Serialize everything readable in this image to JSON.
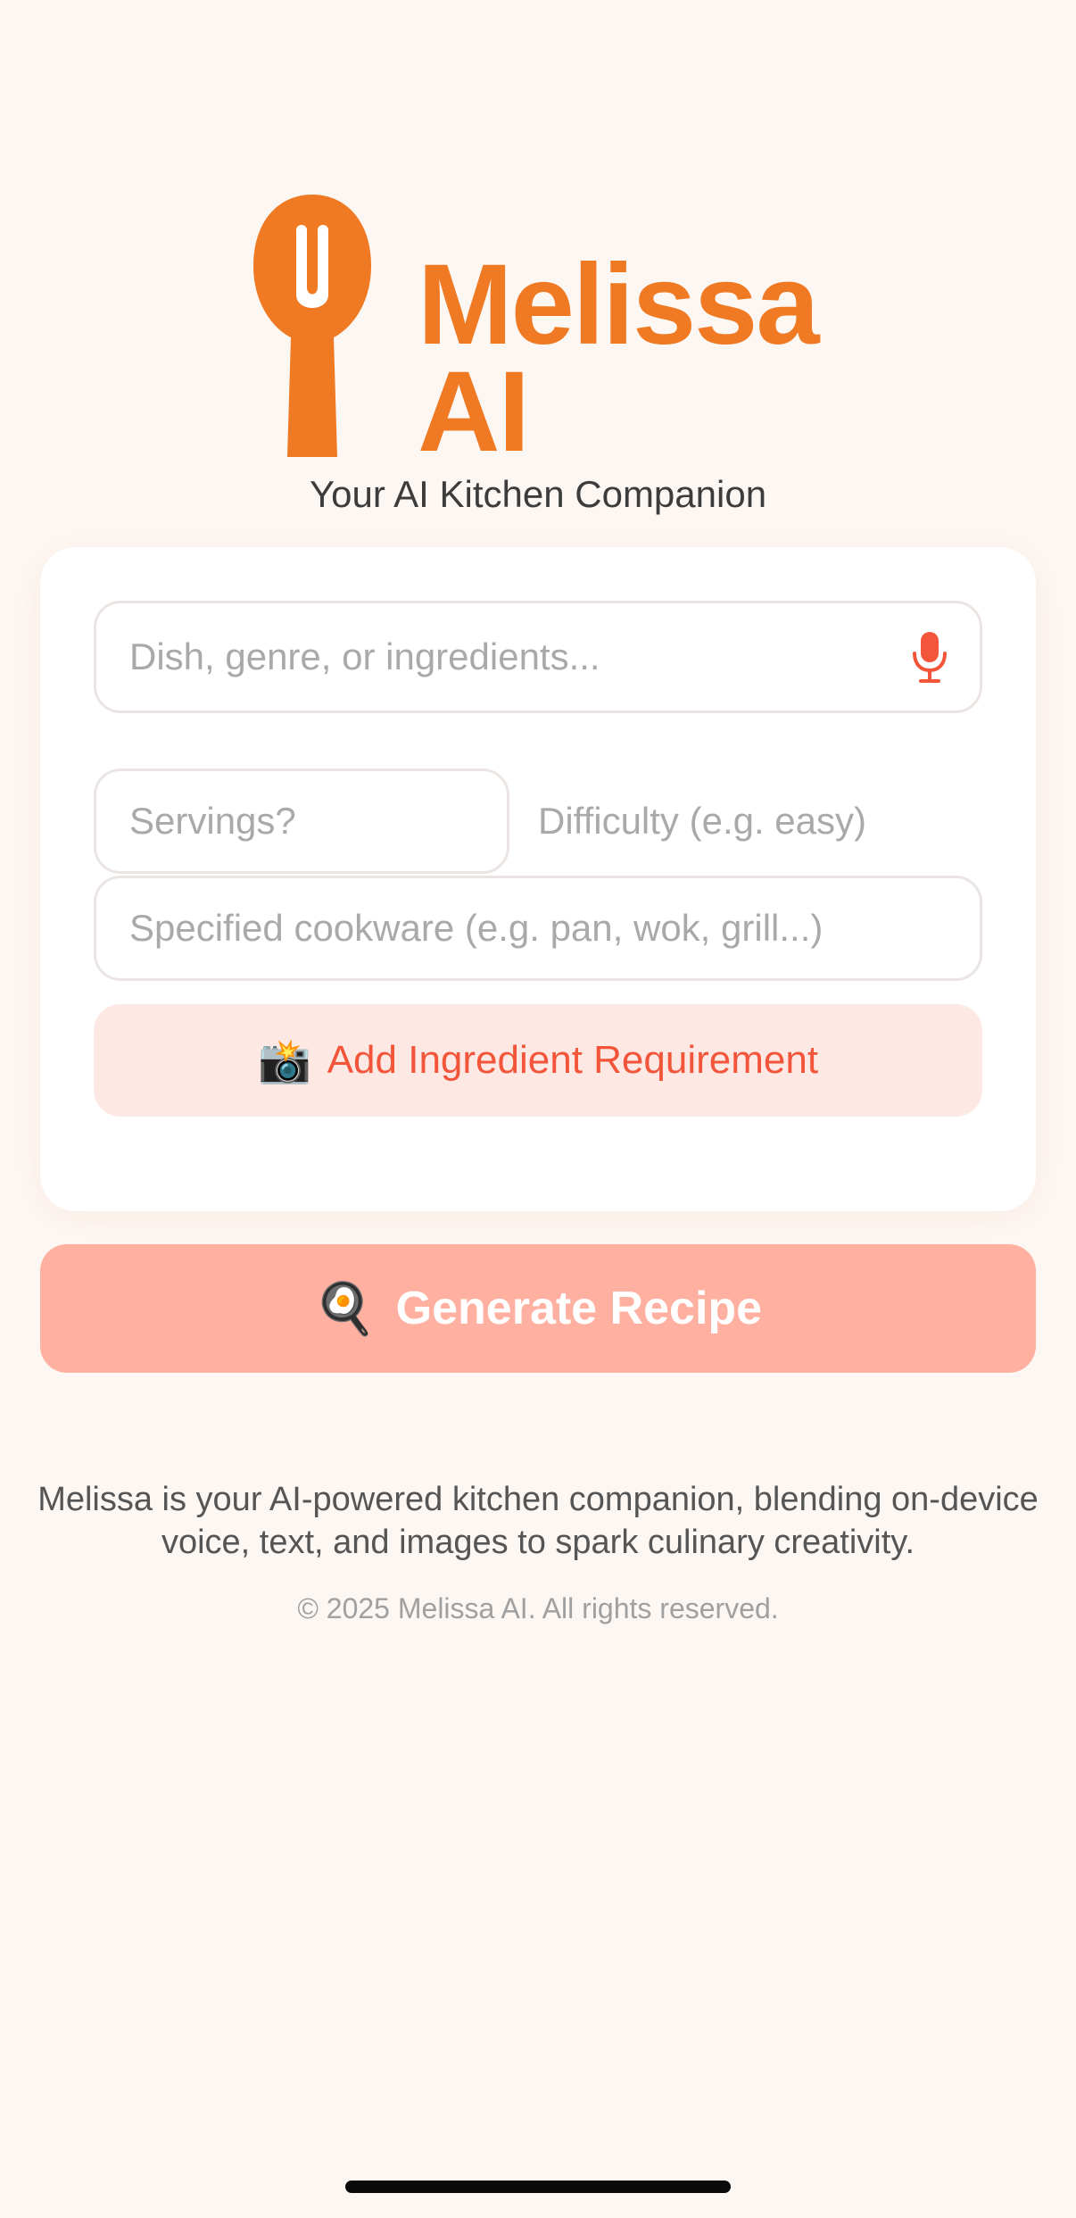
{
  "app": {
    "logo_line1": "Melissa",
    "logo_line2": "AI",
    "tagline": "Your AI Kitchen Companion",
    "brand_color": "#f07a24"
  },
  "form": {
    "dish_placeholder": "Dish, genre, or ingredients...",
    "servings_placeholder": "Servings?",
    "difficulty_placeholder": "Difficulty (e.g. easy)",
    "cookware_placeholder": "Specified cookware (e.g. pan, wok, grill...)",
    "add_ingredient_emoji": "📸",
    "add_ingredient_label": "Add Ingredient Requirement",
    "accent_color": "#f2553a"
  },
  "generate": {
    "emoji": "🍳",
    "label": "Generate Recipe",
    "bg_color": "#ffb0a0"
  },
  "footer": {
    "description": "Melissa is your AI-powered kitchen companion, blending on-device voice, text, and images to spark culinary creativity.",
    "copyright": "© 2025 Melissa AI. All rights reserved."
  },
  "icons": {
    "logo": "spoon-logo-icon",
    "microphone": "microphone-icon"
  }
}
